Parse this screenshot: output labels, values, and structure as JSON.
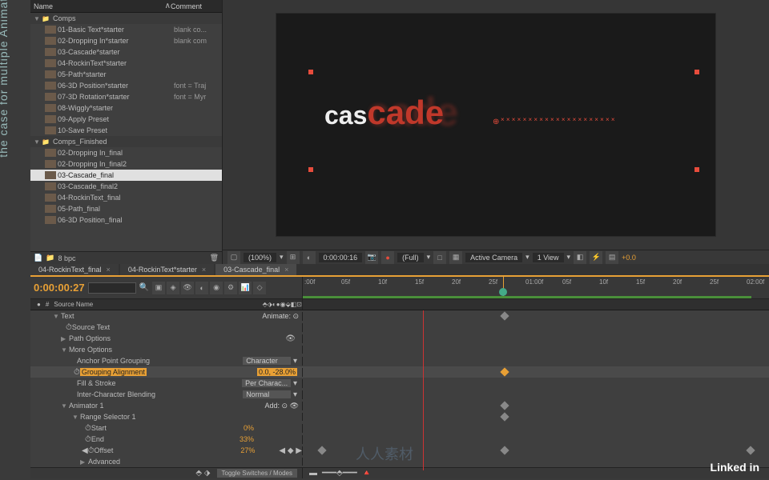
{
  "sidebar_title": "the case for multiple Animators",
  "project": {
    "col_name": "Name",
    "col_comment": "Comment",
    "folders": [
      {
        "name": "Comps",
        "items": [
          {
            "name": "01-Basic Text*starter",
            "comment": "blank co..."
          },
          {
            "name": "02-Dropping In*starter",
            "comment": "blank com"
          },
          {
            "name": "03-Cascade*starter",
            "comment": ""
          },
          {
            "name": "04-RockinText*starter",
            "comment": ""
          },
          {
            "name": "05-Path*starter",
            "comment": ""
          },
          {
            "name": "06-3D Position*starter",
            "comment": "font = Traj"
          },
          {
            "name": "07-3D Rotation*starter",
            "comment": "font = Myr"
          },
          {
            "name": "08-Wiggly*starter",
            "comment": ""
          },
          {
            "name": "09-Apply Preset",
            "comment": ""
          },
          {
            "name": "10-Save Preset",
            "comment": ""
          }
        ]
      },
      {
        "name": "Comps_Finished",
        "items": [
          {
            "name": "02-Dropping In_final",
            "comment": ""
          },
          {
            "name": "02-Dropping In_final2",
            "comment": ""
          },
          {
            "name": "03-Cascade_final",
            "comment": "",
            "selected": true
          },
          {
            "name": "03-Cascade_final2",
            "comment": ""
          },
          {
            "name": "04-RockinText_final",
            "comment": ""
          },
          {
            "name": "05-Path_final",
            "comment": ""
          },
          {
            "name": "06-3D Position_final",
            "comment": ""
          }
        ]
      }
    ],
    "footer_bpc": "8 bpc"
  },
  "preview": {
    "text_white": "cas",
    "text_red": "cade"
  },
  "viewer_toolbar": {
    "zoom": "(100%)",
    "time": "0:00:00:16",
    "res": "(Full)",
    "camera": "Active Camera",
    "view": "1 View",
    "exposure": "+0.0"
  },
  "tabs": [
    {
      "label": "04-RockinText_final"
    },
    {
      "label": "04-RockinText*starter"
    },
    {
      "label": "03-Cascade_final",
      "active": true
    }
  ],
  "timecode": "0:00:00:27",
  "ruler_ticks": [
    ":00f",
    "05f",
    "10f",
    "15f",
    "20f",
    "25f",
    "01:00f",
    "05f",
    "10f",
    "15f",
    "20f",
    "25f",
    "02:00f"
  ],
  "col_headers": {
    "eye": "●",
    "num": "#",
    "source": "Source Name"
  },
  "layers": {
    "text": "Text",
    "animate": "Animate:",
    "source_text": "Source Text",
    "path_options": "Path Options",
    "more_options": "More Options",
    "anchor_point": "Anchor Point Grouping",
    "anchor_val": "Character",
    "grouping": "Grouping Alignment",
    "grouping_val": "0.0, -28.0%",
    "fill_stroke": "Fill & Stroke",
    "fill_val": "Per Charac...",
    "blending": "Inter-Character Blending",
    "blending_val": "Normal",
    "animator1": "Animator 1",
    "add": "Add:",
    "range_sel": "Range Selector 1",
    "start": "Start",
    "start_val": "0%",
    "end": "End",
    "end_val": "33%",
    "offset": "Offset",
    "offset_val": "27%",
    "advanced": "Advanced"
  },
  "toggle_label": "Toggle Switches / Modes",
  "linkedin": "Linked in",
  "watermark": "人人素材"
}
